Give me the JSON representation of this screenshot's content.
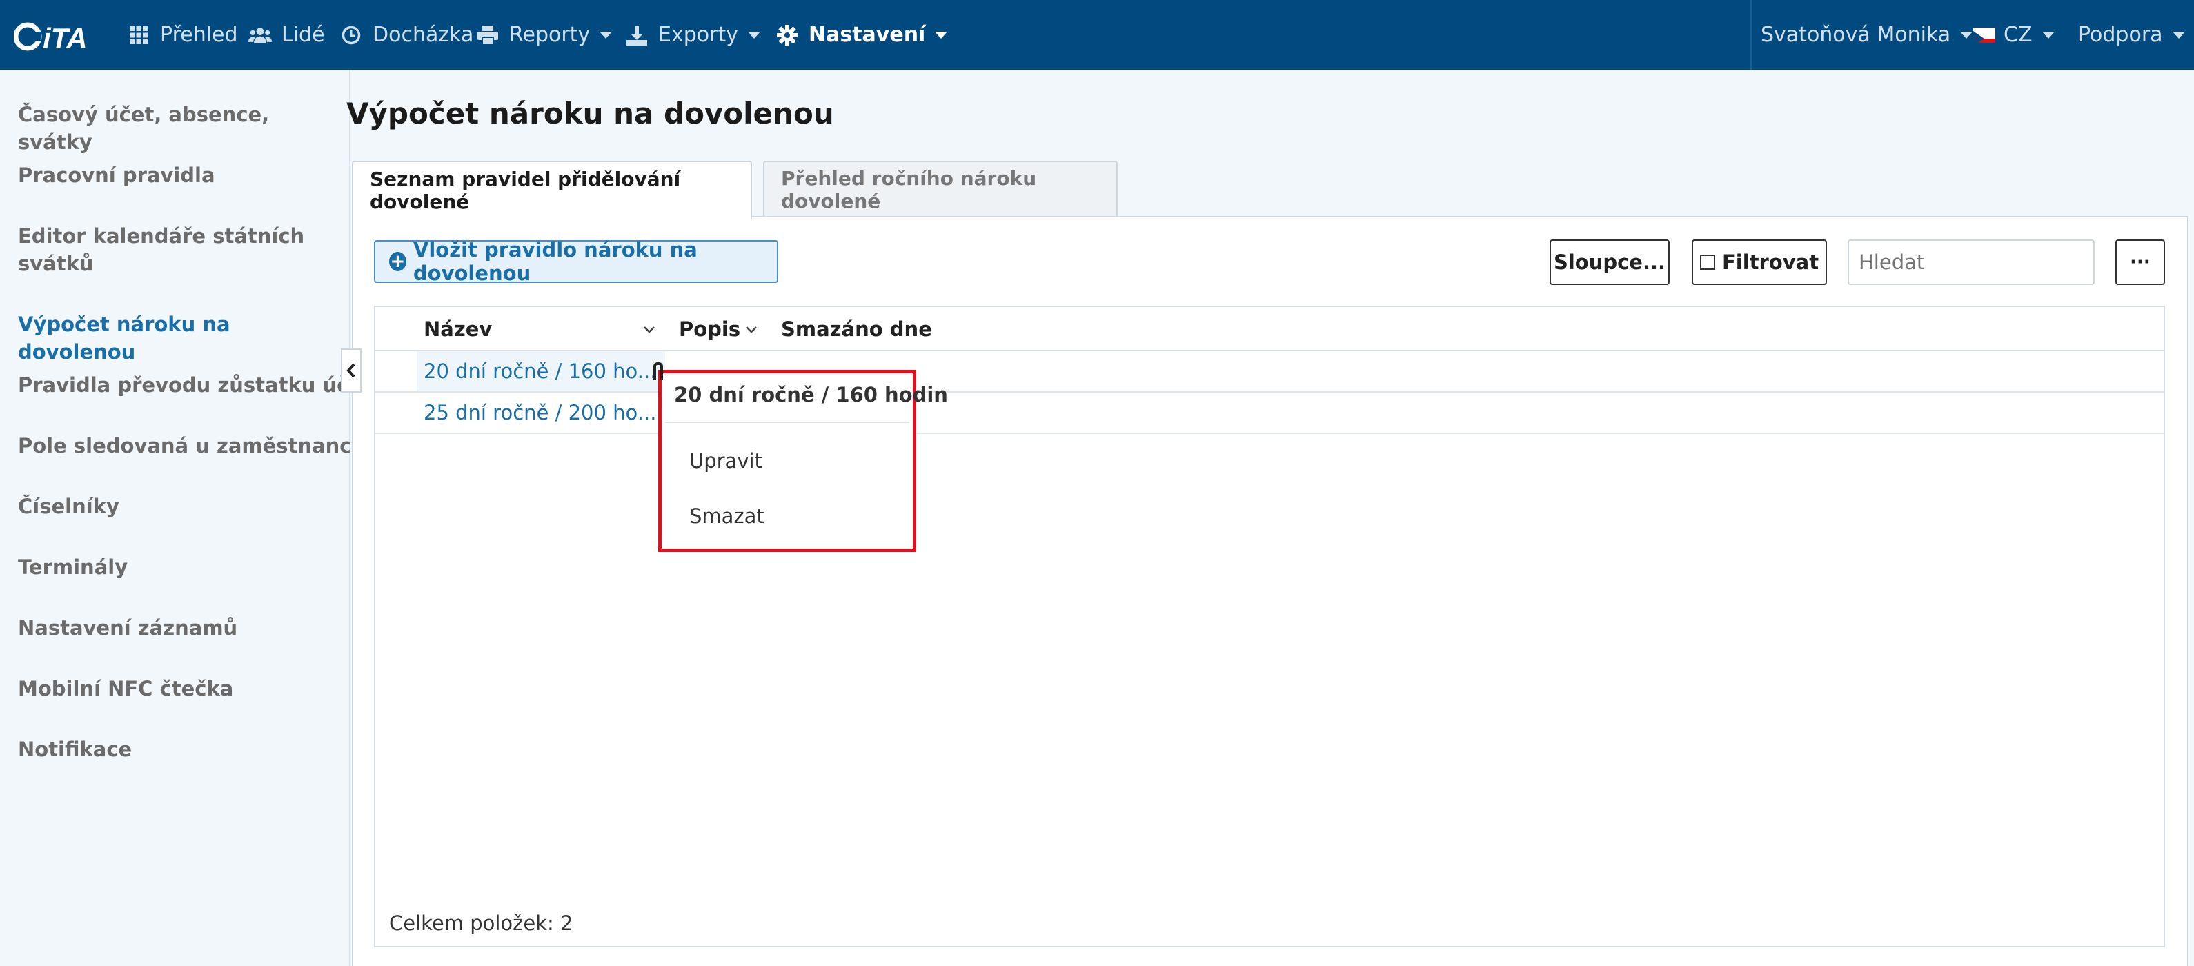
{
  "app": {
    "logo_text": "iTA",
    "colors": {
      "topbar": "#004a80",
      "accent": "#1a6ea8",
      "highlight": "#e0101d"
    }
  },
  "nav": {
    "items": [
      {
        "label": "Přehled",
        "icon": "grid-icon"
      },
      {
        "label": "Lidé",
        "icon": "users-icon"
      },
      {
        "label": "Docházka",
        "icon": "clock-icon"
      },
      {
        "label": "Reporty",
        "icon": "printer-icon"
      },
      {
        "label": "Exporty",
        "icon": "export-icon"
      },
      {
        "label": "Nastavení",
        "icon": "gear-icon"
      }
    ],
    "user": "Svatoňová Monika",
    "language": "CZ",
    "support": "Podpora"
  },
  "sidebar": {
    "items": [
      {
        "label": "Časový účet, absence, svátky"
      },
      {
        "label": "Pracovní pravidla"
      },
      {
        "label": "Editor kalendáře státních svátků"
      },
      {
        "label": "Výpočet nároku na dovolenou"
      },
      {
        "label": "Pravidla převodu zůstatku účtů"
      },
      {
        "label": "Pole sledovaná u zaměstnanců"
      },
      {
        "label": "Číselníky"
      },
      {
        "label": "Terminály"
      },
      {
        "label": "Nastavení záznamů"
      },
      {
        "label": "Mobilní NFC čtečka"
      },
      {
        "label": "Notifikace"
      }
    ]
  },
  "main": {
    "title": "Výpočet nároku na dovolenou",
    "tabs": [
      {
        "label": "Seznam pravidel přidělování dovolené"
      },
      {
        "label": "Přehled ročního nároku dovolené"
      }
    ],
    "toolbar": {
      "insert_label": "Vložit pravidlo nároku na dovolenou",
      "columns_label": "Sloupce...",
      "filter_label": "Filtrovat",
      "search_placeholder": "Hledat",
      "more_label": "···"
    },
    "table": {
      "columns": [
        "Název",
        "Popis",
        "Smazáno dne"
      ],
      "rows": [
        {
          "name": "20 dní ročně / 160 ho..."
        },
        {
          "name": "25 dní ročně / 200 ho..."
        }
      ],
      "total": "Celkem položek: 2"
    },
    "popup": {
      "title": "20 dní ročně / 160 hodin",
      "items": [
        "Upravit",
        "Smazat"
      ]
    }
  }
}
